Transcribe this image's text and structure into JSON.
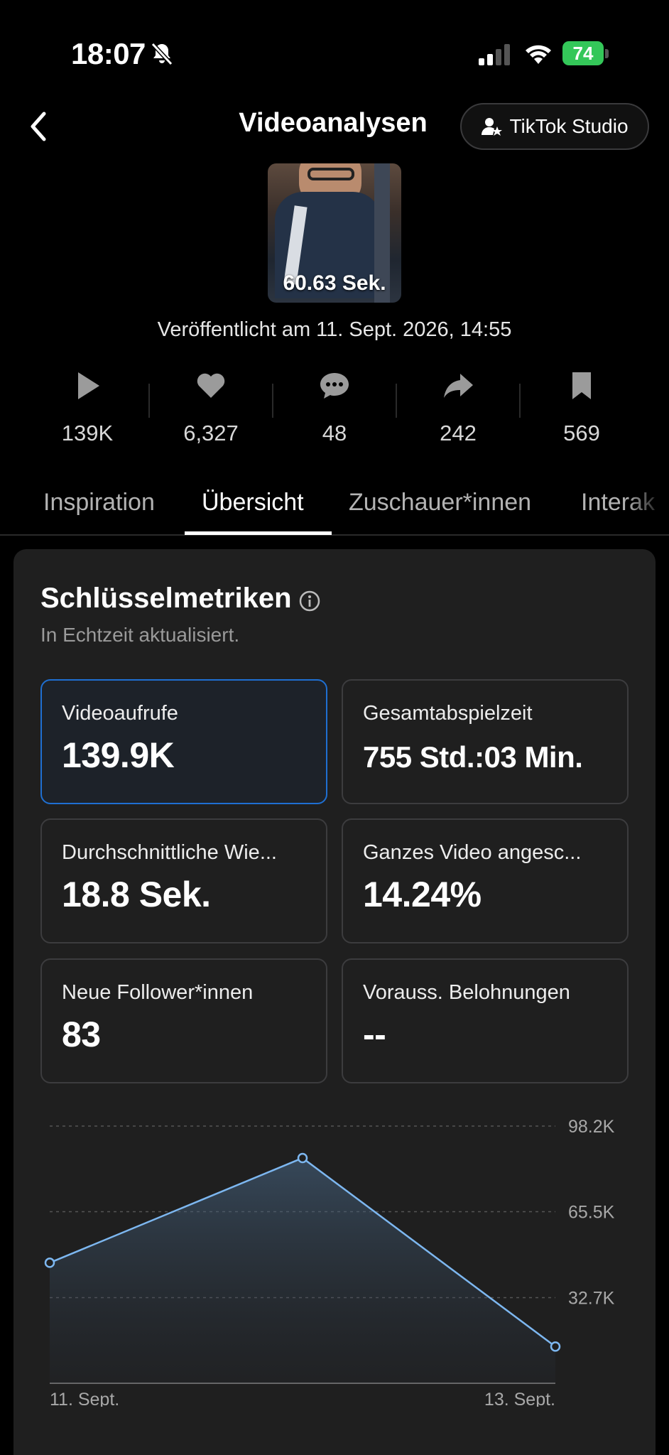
{
  "status_bar": {
    "time": "18:07",
    "battery": "74"
  },
  "header": {
    "title": "Videoanalysen",
    "studio_button": "TikTok Studio"
  },
  "video": {
    "duration": "60.63 Sek.",
    "published": "Veröffentlicht am 11. Sept. 2026, 14:55"
  },
  "stats": [
    {
      "icon": "play-icon",
      "value": "139K"
    },
    {
      "icon": "heart-icon",
      "value": "6,327"
    },
    {
      "icon": "comment-icon",
      "value": "48"
    },
    {
      "icon": "share-icon",
      "value": "242"
    },
    {
      "icon": "bookmark-icon",
      "value": "569"
    }
  ],
  "tabs": [
    {
      "label": "Inspiration",
      "active": false
    },
    {
      "label": "Übersicht",
      "active": true
    },
    {
      "label": "Zuschauer*innen",
      "active": false
    },
    {
      "label": "Interak",
      "active": false
    }
  ],
  "key_metrics": {
    "title": "Schlüsselmetriken",
    "subtitle": "In Echtzeit aktualisiert.",
    "items": [
      {
        "label": "Videoaufrufe",
        "value": "139.9K",
        "selected": true
      },
      {
        "label": "Gesamtabspielzeit",
        "value": "755 Std.:03 Min.",
        "selected": false
      },
      {
        "label": "Durchschnittliche Wie...",
        "value": "18.8 Sek.",
        "selected": false
      },
      {
        "label": "Ganzes Video angesc...",
        "value": "14.24%",
        "selected": false
      },
      {
        "label": "Neue Follower*innen",
        "value": "83",
        "selected": false
      },
      {
        "label": "Vorauss. Belohnungen",
        "value": "--",
        "selected": false
      }
    ]
  },
  "chart_data": {
    "type": "area",
    "x": [
      "11. Sept.",
      "12. Sept.",
      "13. Sept."
    ],
    "x_tick_labels": [
      "11. Sept.",
      "13. Sept."
    ],
    "values": [
      46000,
      86000,
      14000
    ],
    "y_ticks": [
      32700,
      65500,
      98200
    ],
    "y_tick_labels": [
      "32.7K",
      "65.5K",
      "98.2K"
    ],
    "ylim": [
      0,
      98200
    ],
    "grid": true,
    "line_color": "#7db7f0"
  }
}
